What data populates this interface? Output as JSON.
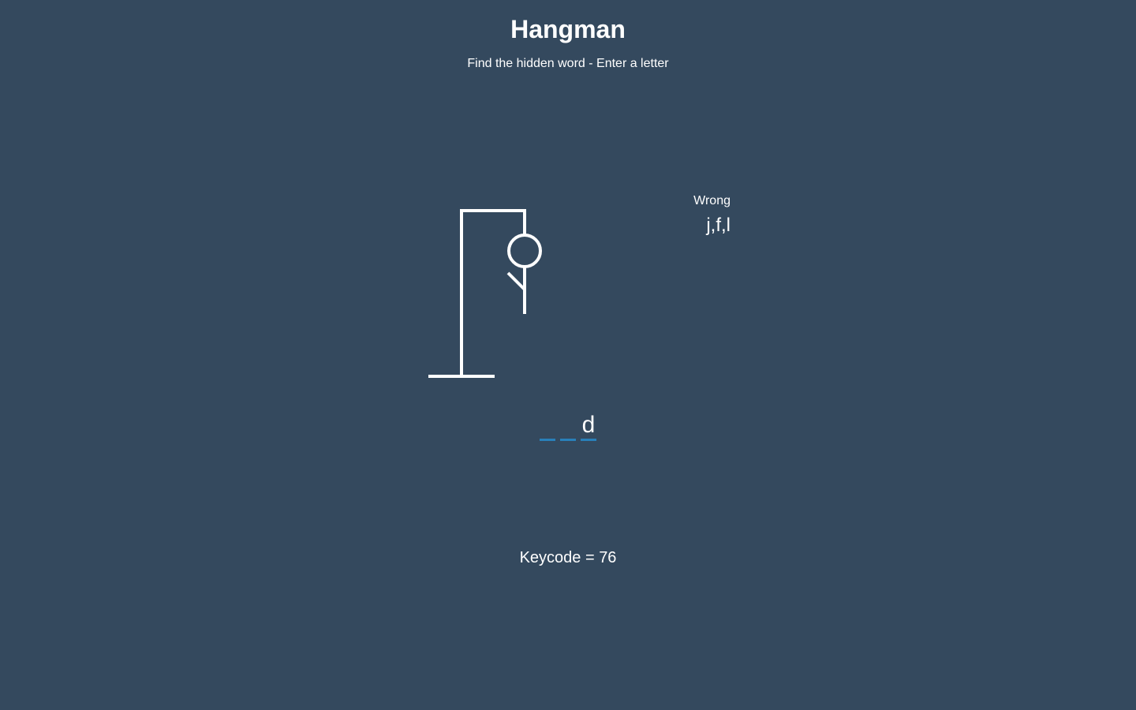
{
  "header": {
    "title": "Hangman",
    "subtitle": "Find the hidden word - Enter a letter"
  },
  "wrong": {
    "label": "Wrong",
    "letters": "j,f,l"
  },
  "word": {
    "letters": [
      "",
      "",
      "d"
    ]
  },
  "keycode": {
    "label": "Keycode = ",
    "value": "76"
  },
  "hangman": {
    "wrong_count": 3,
    "drawn_parts": [
      "head",
      "body",
      "left-arm"
    ]
  },
  "colors": {
    "background": "#34495e",
    "text": "#ffffff",
    "underline": "#2980b9"
  }
}
